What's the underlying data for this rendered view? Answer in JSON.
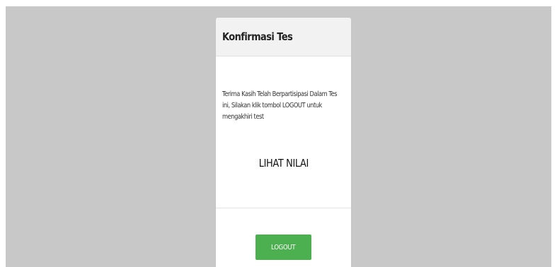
{
  "card": {
    "title": "Konfirmasi Tes",
    "message": "Terima Kasih Telah Berpartisipasi Dalam Tes ini, Silakan klik tombol LOGOUT untuk mengakhiri test",
    "view_score_label": "LIHAT NILAI",
    "logout_label": "LOGOUT"
  },
  "colors": {
    "backdrop": "#c8c8c8",
    "header_bg": "#f2f2f2",
    "button_green": "#4caf50"
  }
}
